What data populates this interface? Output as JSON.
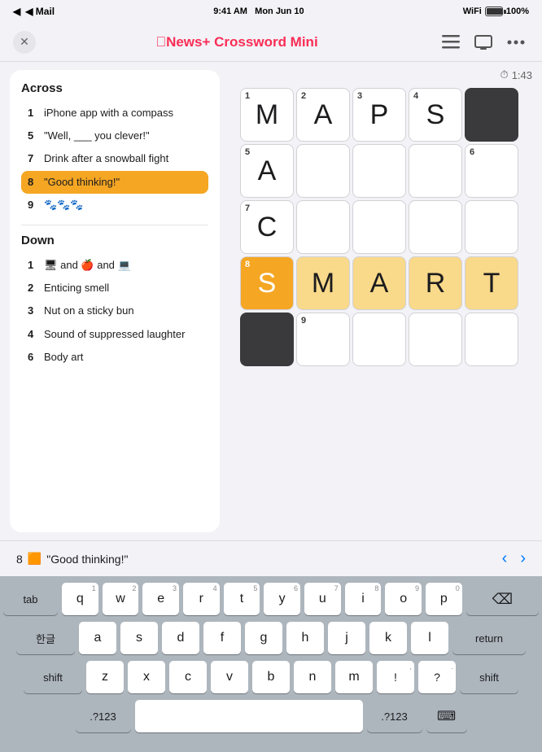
{
  "statusBar": {
    "left": "◀ Mail",
    "time": "9:41 AM",
    "date": "Mon Jun 10",
    "wifi": "WiFi",
    "battery": "100%"
  },
  "navBar": {
    "title": "News+ Crossword Mini",
    "titlePrefix": "Apple"
  },
  "timer": {
    "label": "1:43",
    "icon": "⏱"
  },
  "clues": {
    "across": {
      "title": "Across",
      "items": [
        {
          "number": "1",
          "text": "iPhone app with a compass"
        },
        {
          "number": "5",
          "text": "\"Well, ___ you clever!\""
        },
        {
          "number": "7",
          "text": "Drink after a snowball fight"
        },
        {
          "number": "8",
          "text": "\"Good thinking!\"",
          "active": true
        },
        {
          "number": "9",
          "text": "🐾🐾🐾"
        }
      ]
    },
    "down": {
      "title": "Down",
      "items": [
        {
          "number": "1",
          "text": "🖥 and 🍎 and 💻"
        },
        {
          "number": "2",
          "text": "Enticing smell"
        },
        {
          "number": "3",
          "text": "Nut on a sticky bun"
        },
        {
          "number": "4",
          "text": "Sound of suppressed laughter"
        },
        {
          "number": "6",
          "text": "Body art"
        }
      ]
    }
  },
  "grid": {
    "cells": [
      {
        "row": 0,
        "col": 0,
        "num": "1",
        "letter": "M",
        "state": "normal"
      },
      {
        "row": 0,
        "col": 1,
        "num": "2",
        "letter": "A",
        "state": "normal"
      },
      {
        "row": 0,
        "col": 2,
        "num": "3",
        "letter": "P",
        "state": "normal"
      },
      {
        "row": 0,
        "col": 3,
        "num": "4",
        "letter": "S",
        "state": "normal"
      },
      {
        "row": 0,
        "col": 4,
        "letter": "",
        "state": "black"
      },
      {
        "row": 1,
        "col": 0,
        "num": "5",
        "letter": "A",
        "state": "normal"
      },
      {
        "row": 1,
        "col": 1,
        "letter": "",
        "state": "empty"
      },
      {
        "row": 1,
        "col": 2,
        "letter": "",
        "state": "empty"
      },
      {
        "row": 1,
        "col": 3,
        "letter": "",
        "state": "empty"
      },
      {
        "row": 1,
        "col": 4,
        "num": "6",
        "letter": "",
        "state": "empty"
      },
      {
        "row": 2,
        "col": 0,
        "num": "7",
        "letter": "C",
        "state": "normal"
      },
      {
        "row": 2,
        "col": 1,
        "letter": "",
        "state": "empty"
      },
      {
        "row": 2,
        "col": 2,
        "letter": "",
        "state": "empty"
      },
      {
        "row": 2,
        "col": 3,
        "letter": "",
        "state": "empty"
      },
      {
        "row": 2,
        "col": 4,
        "letter": "",
        "state": "empty"
      },
      {
        "row": 3,
        "col": 0,
        "num": "8",
        "letter": "S",
        "state": "active"
      },
      {
        "row": 3,
        "col": 1,
        "letter": "M",
        "state": "highlighted"
      },
      {
        "row": 3,
        "col": 2,
        "letter": "A",
        "state": "highlighted"
      },
      {
        "row": 3,
        "col": 3,
        "letter": "R",
        "state": "highlighted"
      },
      {
        "row": 3,
        "col": 4,
        "letter": "T",
        "state": "highlighted"
      },
      {
        "row": 4,
        "col": 0,
        "letter": "",
        "state": "black"
      },
      {
        "row": 4,
        "col": 1,
        "num": "9",
        "letter": "",
        "state": "empty"
      },
      {
        "row": 4,
        "col": 2,
        "letter": "",
        "state": "empty"
      },
      {
        "row": 4,
        "col": 3,
        "letter": "",
        "state": "empty"
      },
      {
        "row": 4,
        "col": 4,
        "letter": "",
        "state": "empty"
      }
    ]
  },
  "clueHint": {
    "clueNum": "8",
    "icon": "🔶",
    "text": "\"Good thinking!\""
  },
  "keyboard": {
    "rows": [
      [
        "q",
        "w",
        "e",
        "r",
        "t",
        "y",
        "u",
        "i",
        "o",
        "p"
      ],
      [
        "a",
        "s",
        "d",
        "f",
        "g",
        "h",
        "j",
        "k",
        "l"
      ],
      [
        "z",
        "x",
        "c",
        "v",
        "b",
        "n",
        "m"
      ]
    ],
    "subNumbers": {
      "q": "1",
      "w": "2",
      "e": "3",
      "r": "4",
      "t": "5",
      "y": "6",
      "u": "7",
      "i": "8",
      "o": "9",
      "p": "0",
      "a": "",
      "s": "",
      "d": "",
      "f": "",
      "g": "",
      "h": "",
      "j": "",
      "k": "",
      "l": "",
      "z": "",
      "x": "",
      "c": "",
      "v": "",
      "b": "",
      "n": "",
      "m": ""
    },
    "tabLabel": "tab",
    "korLabel": "한글",
    "shiftLabel": "shift",
    "deleteLabel": "⌫",
    "returnLabel": "return",
    "symbolLabel": ".?123",
    "symbolLabel2": ".?123",
    "keyboardLabel": "⌨"
  }
}
